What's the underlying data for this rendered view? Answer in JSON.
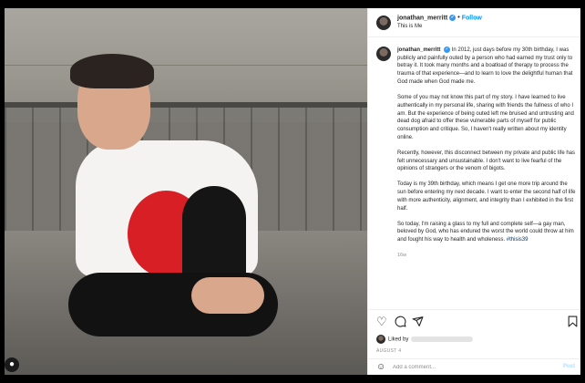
{
  "post": {
    "username": "jonathan_merritt",
    "follow_label": "Follow",
    "dot": "•",
    "subtitle": "This is Me",
    "caption": {
      "username": "jonathan_merritt",
      "p1": "In 2012, just days before my 30th birthday, I was publicly and painfully outed by a person who had earned my trust only to betray it. It took many months and a boatload of therapy to process the trauma of that experience—and to learn to love the delightful human that God made when God made me.",
      "p2": "Some of you may not know this part of my story. I have learned to live authentically in my personal life, sharing with friends the fullness of who I am. But the experience of being outed left me bruised and untrusting and dead dog afraid to offer these vulnerable parts of myself for public consumption and critique. So, I haven't really written about my identity online.",
      "p3": "Recently, however, this disconnect between my private and public life has felt unnecessary and unsustainable. I don't want to live fearful of the opinions of strangers or the venom of bigots.",
      "p4": "Today is my 39th birthday, which means I get one more trip around the sun before entering my next decade. I want to enter the second half of life with more authenticity, alignment, and integrity than I exhibited in the first half.",
      "p5": "So today, I'm raising a glass to my full and complete self—a gay man, beloved by God, who has endured the worst the world could throw at him and fought his way to health and wholeness.",
      "hashtag": "#thisis39",
      "time": "16w"
    },
    "more_label": "+",
    "liked_prefix": "Liked by",
    "date": "AUGUST 4",
    "comment_placeholder": "Add a comment...",
    "post_label": "Post"
  },
  "icons": {
    "heart": "heart-icon",
    "comment": "comment-icon",
    "share": "share-icon",
    "save": "bookmark-icon",
    "emoji": "emoji-icon",
    "verified": "verified-badge-icon",
    "user_tag": "user-tag-icon"
  },
  "colors": {
    "link_blue": "#0095f6",
    "verified_blue": "#3897f0",
    "shirt_red": "#d81f26",
    "hashtag": "#00376b"
  }
}
